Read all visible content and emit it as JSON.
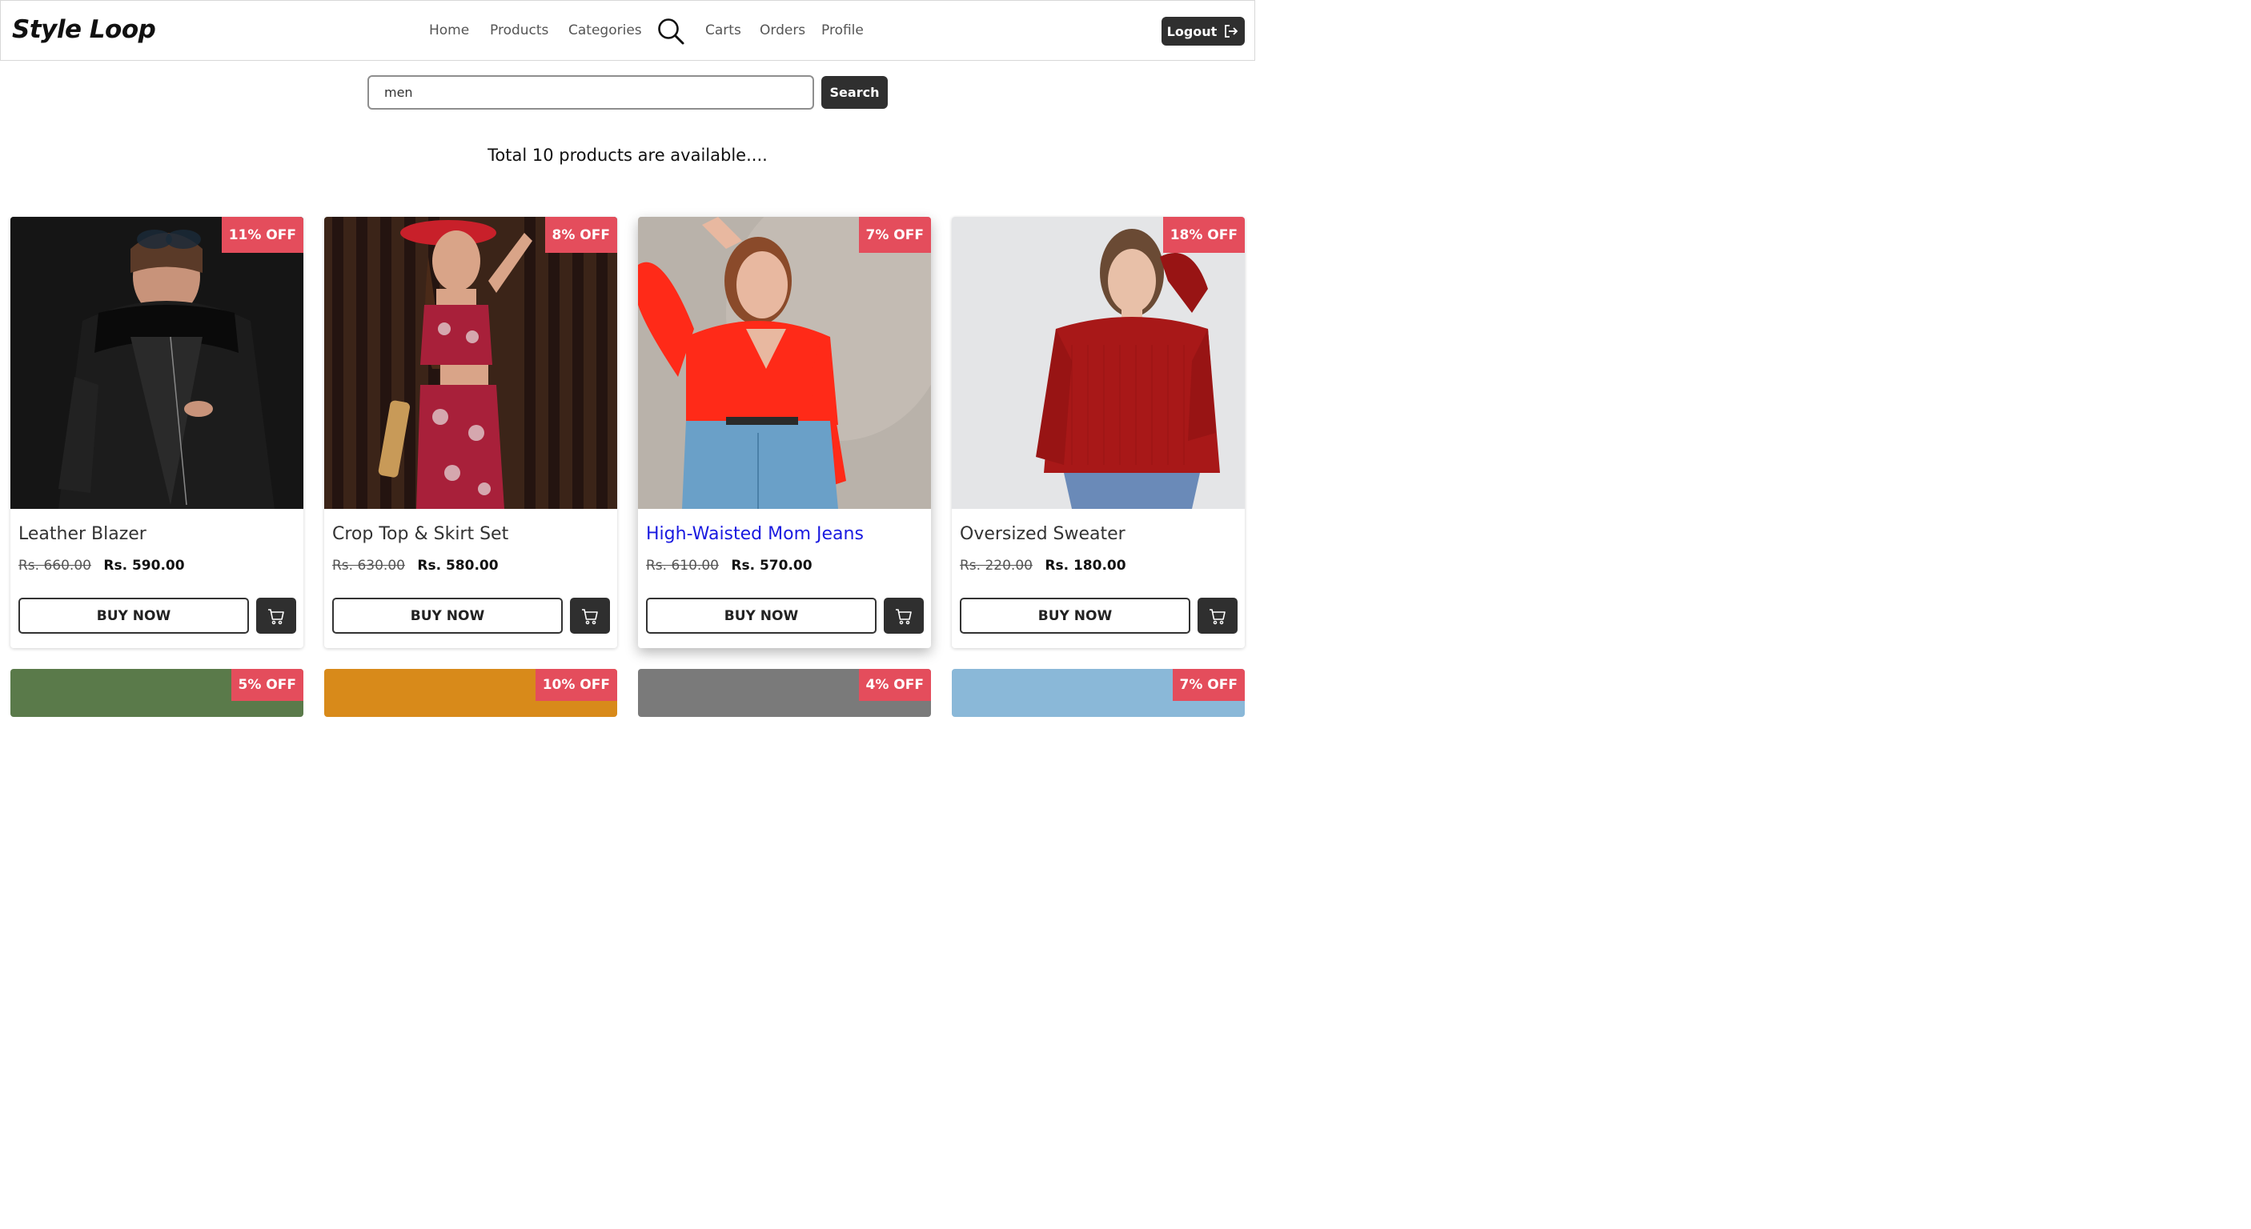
{
  "brand": "Style Loop",
  "nav": {
    "links": [
      {
        "label": "Home"
      },
      {
        "label": "Products"
      },
      {
        "label": "Categories"
      },
      {
        "label": "Carts"
      },
      {
        "label": "Orders"
      },
      {
        "label": "Profile"
      }
    ],
    "logout_label": "Logout"
  },
  "search": {
    "value": "men",
    "button_label": "Search"
  },
  "total_text": "Total 10 products are available....",
  "products": [
    {
      "name": "Leather Blazer",
      "badge": "11% OFF",
      "old_price": "Rs. 660.00",
      "new_price": "Rs. 590.00",
      "buy_label": "BUY NOW"
    },
    {
      "name": "Crop Top & Skirt Set",
      "badge": "8% OFF",
      "old_price": "Rs. 630.00",
      "new_price": "Rs. 580.00",
      "buy_label": "BUY NOW"
    },
    {
      "name": "High-Waisted Mom Jeans",
      "badge": "7% OFF",
      "old_price": "Rs. 610.00",
      "new_price": "Rs. 570.00",
      "buy_label": "BUY NOW"
    },
    {
      "name": "Oversized Sweater",
      "badge": "18% OFF",
      "old_price": "Rs. 220.00",
      "new_price": "Rs. 180.00",
      "buy_label": "BUY NOW"
    }
  ],
  "second_row_badges": [
    "5% OFF",
    "10% OFF",
    "4% OFF",
    "7% OFF"
  ],
  "colors": {
    "badge": "#e44d5c",
    "dark_button": "#2f2f2f",
    "link_hover": "#1a1ae0"
  }
}
